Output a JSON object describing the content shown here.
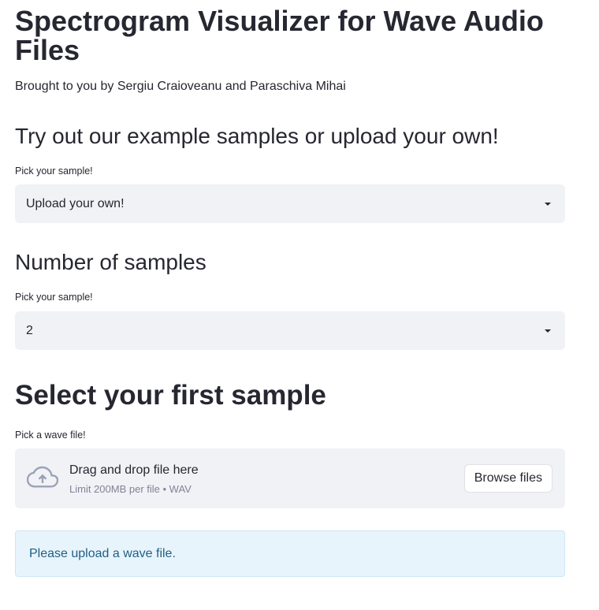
{
  "header": {
    "title": "Spectrogram Visualizer for Wave Audio Files",
    "subtitle": "Brought to you by Sergiu Craioveanu and Paraschiva Mihai"
  },
  "sample_section": {
    "heading": "Try out our example samples or upload your own!",
    "select_label": "Pick your sample!",
    "select_value": "Upload your own!"
  },
  "count_section": {
    "heading": "Number of samples",
    "select_label": "Pick your sample!",
    "select_value": "2"
  },
  "first_sample_section": {
    "heading": "Select your first sample",
    "uploader_label": "Pick a wave file!",
    "drop_text": "Drag and drop file here",
    "limit_text": "Limit 200MB per file • WAV",
    "browse_label": "Browse files",
    "info_message": "Please upload a wave file."
  },
  "icons": {
    "upload": "cloud-upload-icon",
    "dropdown": "chevron-down-icon"
  },
  "colors": {
    "text": "#262730",
    "input_bg": "#f0f2f6",
    "info_bg": "#e8f4fc",
    "info_text": "#1f5f86",
    "muted": "#808495"
  }
}
